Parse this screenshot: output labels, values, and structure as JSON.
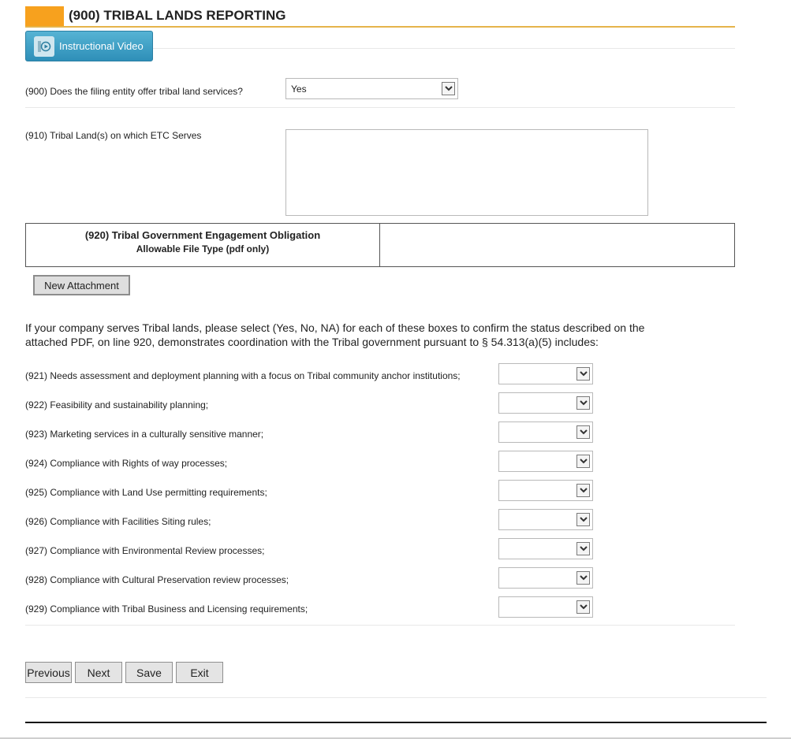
{
  "header": {
    "title": "(900) TRIBAL LANDS REPORTING"
  },
  "video_button": {
    "label": "Instructional Video"
  },
  "q900": {
    "label": "(900) Does the filing entity offer tribal land services?",
    "value": "Yes"
  },
  "q910": {
    "label": "(910) Tribal Land(s) on which ETC Serves",
    "value": ""
  },
  "q920": {
    "title": "(920) Tribal Government Engagement Obligation",
    "file_type": "Allowable File Type (pdf only)"
  },
  "attachment": {
    "new_label": "New Attachment"
  },
  "intro": "If your company serves Tribal lands, please select (Yes, No, NA) for each of these boxes to confirm the status described on the attached PDF, on line 920, demonstrates coordination with the Tribal government pursuant to § 54.313(a)(5) includes:",
  "items": [
    {
      "label": "(921) Needs assessment and deployment planning with a focus on Tribal community anchor institutions;",
      "value": ""
    },
    {
      "label": "(922) Feasibility and sustainability planning;",
      "value": ""
    },
    {
      "label": "(923) Marketing services in a culturally sensitive manner;",
      "value": ""
    },
    {
      "label": "(924) Compliance with Rights of way processes;",
      "value": ""
    },
    {
      "label": "(925) Compliance with Land Use permitting requirements;",
      "value": ""
    },
    {
      "label": "(926) Compliance with Facilities Siting rules;",
      "value": ""
    },
    {
      "label": "(927) Compliance with Environmental Review processes;",
      "value": ""
    },
    {
      "label": "(928) Compliance with Cultural Preservation review processes;",
      "value": ""
    },
    {
      "label": "(929) Compliance with Tribal Business and Licensing requirements;",
      "value": ""
    }
  ],
  "nav": {
    "previous": "Previous",
    "next": "Next",
    "save": "Save",
    "exit": "Exit"
  },
  "colors": {
    "accent": "#f7a11e",
    "video_button": "#3a9cc4"
  }
}
